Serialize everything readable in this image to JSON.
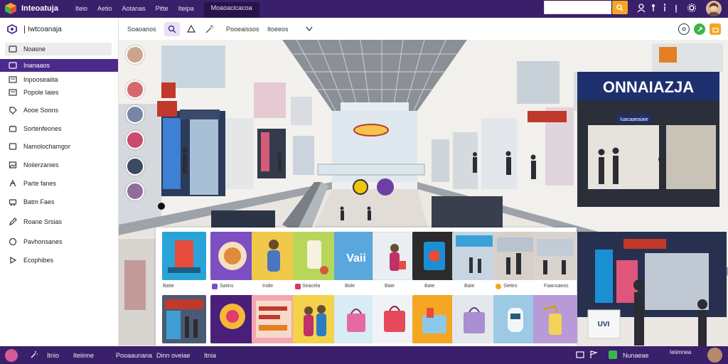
{
  "topbar": {
    "brand": "Inteoatuja",
    "nav": [
      "Iteio",
      "Aetio",
      "Aotanas",
      "Pitte",
      "Iteipa"
    ],
    "active_tab": "Moaoacicacoa",
    "search_placeholder": ""
  },
  "sidebar": {
    "title": "Iwtcoanaja",
    "items": [
      {
        "label": "Noasne",
        "icon": "rectangle-icon"
      },
      {
        "label": "Inanaaos",
        "icon": "rectangle-icon"
      },
      {
        "label": "Inpooseaiita",
        "icon": "checkbox-icon"
      },
      {
        "label": "Popole Iaies",
        "icon": "checkbox-icon"
      },
      {
        "label": "Aooe Soons",
        "icon": "tag-icon"
      },
      {
        "label": "Sortenfeones",
        "icon": "box-icon"
      },
      {
        "label": "Namolochamgor",
        "icon": "box-icon"
      },
      {
        "label": "Noiierzanies",
        "icon": "image-icon"
      },
      {
        "label": "Parte fanes",
        "icon": "flow-icon"
      },
      {
        "label": "Batm Faes",
        "icon": "cart-icon"
      },
      {
        "label": "Roane Srsias",
        "icon": "pencil-icon"
      },
      {
        "label": "Pavhonsanes",
        "icon": "circle-icon"
      },
      {
        "label": "Ecophibes",
        "icon": "arrow-icon"
      }
    ]
  },
  "toolbar": {
    "items": [
      "Soaoanos",
      "Pooeaissos",
      "Itoeeos"
    ]
  },
  "scene": {
    "store_sign": "ONNAIAZJA",
    "store_sub": "Iuacaaeaiaie"
  },
  "products": {
    "row1_labels": [
      "Batie",
      "Satins",
      "Indie",
      "Seacela",
      "Bole",
      "Baie",
      "Bate",
      "Bate",
      "Sietes",
      "Faansaeos"
    ],
    "row2_labels": []
  },
  "bottombar": {
    "items": [
      "Itnio",
      "Iteiinne",
      "Pooaaunana",
      "Dinn oveiae",
      "Itnia"
    ],
    "right_item": "Nunaeae",
    "right_item2": "Ieiimnea"
  },
  "colors": {
    "primary": "#3a1f6a",
    "sidebar_active": "#4a2a8a",
    "accent": "#f5a623",
    "green": "#3bb54a"
  }
}
